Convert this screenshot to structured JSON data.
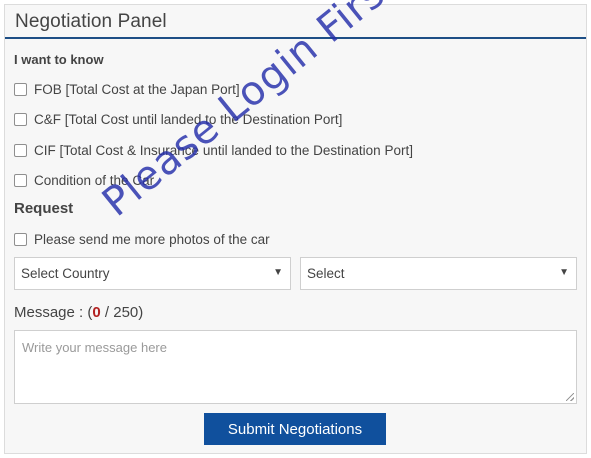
{
  "panel": {
    "title": "Negotiation Panel"
  },
  "know_section": {
    "title": "I want to know",
    "options": [
      "FOB [Total Cost at the Japan Port]",
      "C&F [Total Cost until landed to the Destination Port]",
      "CIF [Total Cost & Insurance until landed to the Destination Port]",
      "Condition of the Car"
    ]
  },
  "request_section": {
    "title": "Request",
    "options": [
      "Please send me more photos of the car"
    ]
  },
  "selects": {
    "country": "Select Country",
    "port": "Select"
  },
  "message": {
    "label_prefix": "Message : (",
    "count_current": "0",
    "count_separator": " / ",
    "count_max": "250",
    "label_suffix": ")",
    "placeholder": "Write your message here"
  },
  "submit_label": "Submit Negotiations",
  "watermark_text": "Please Login First !!",
  "colors": {
    "accent": "#10509d",
    "header_rule": "#1e4f86",
    "count_current": "#b22222",
    "watermark": "#232daa"
  }
}
